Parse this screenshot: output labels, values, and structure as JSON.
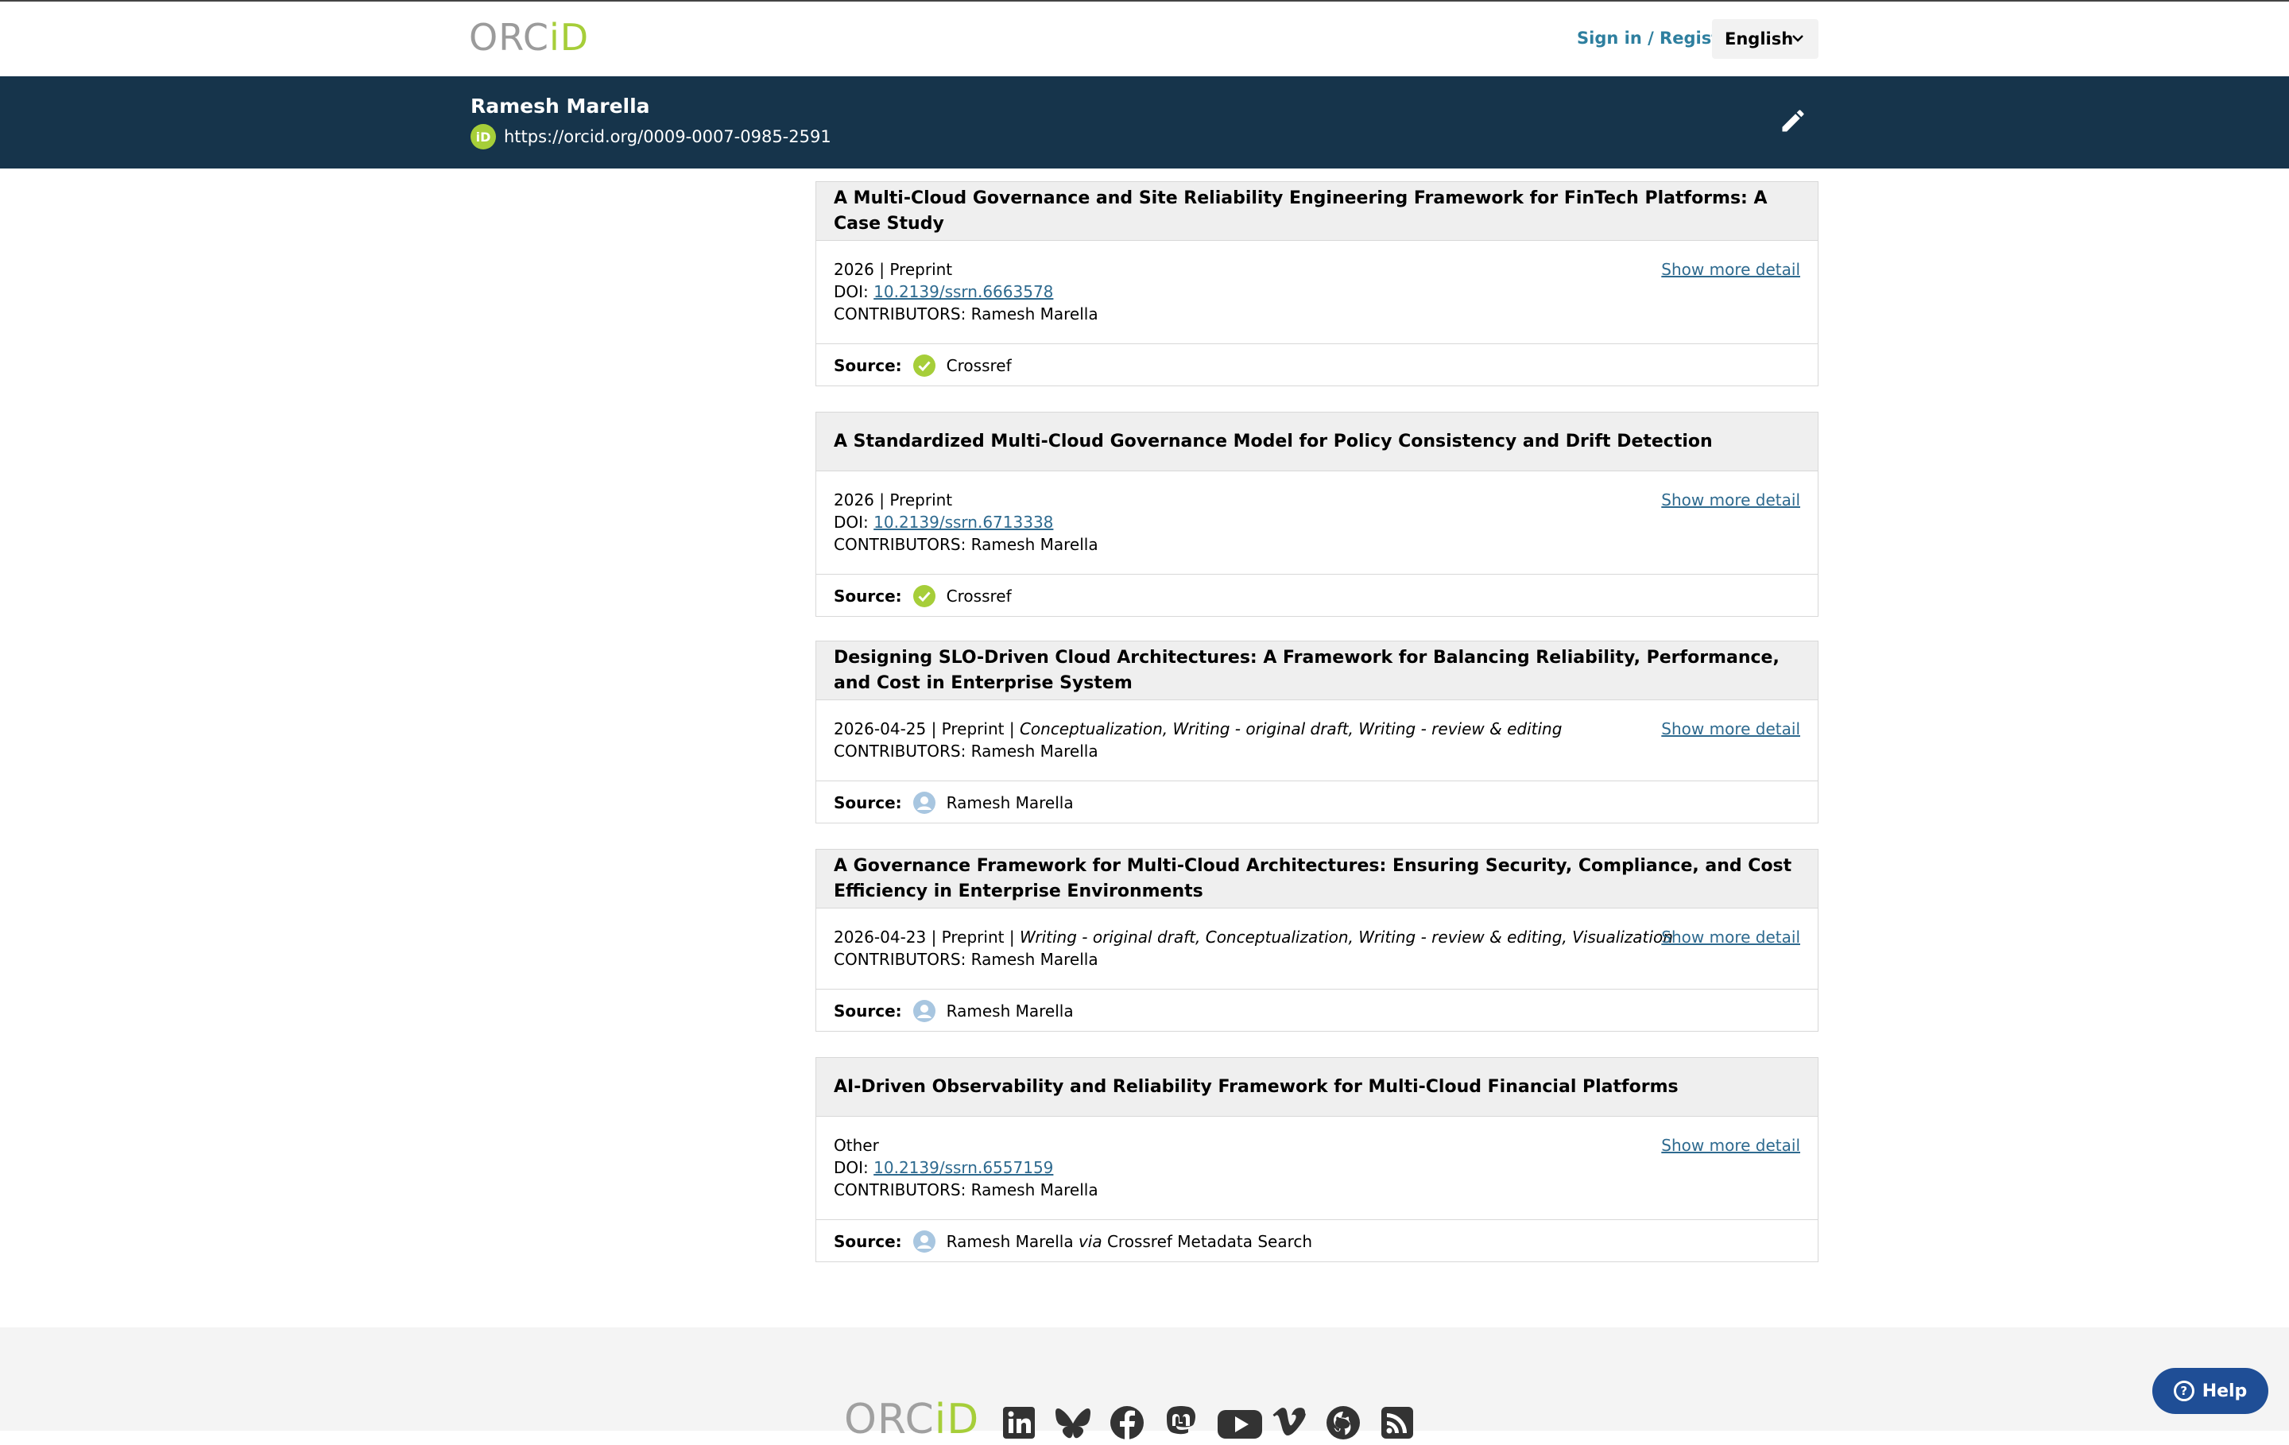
{
  "header": {
    "logo_orc": "ORC",
    "logo_id": "iD",
    "signin_label": "Sign in / Register",
    "language": "English"
  },
  "profile": {
    "name": "Ramesh Marella",
    "id_badge": "iD",
    "orcid_url": "https://orcid.org/0009-0007-0985-2591"
  },
  "works": [
    {
      "title": "A Multi-Cloud Governance and Site Reliability Engineering Framework for FinTech Platforms: A Case Study",
      "meta": "2026 | Preprint",
      "doi_label": "DOI: ",
      "doi": "10.2139/ssrn.6663578",
      "contributors": "CONTRIBUTORS: Ramesh Marella",
      "more": "Show more detail",
      "source_label": "Source:",
      "source": "Crossref",
      "source_icon": "check-circle-icon"
    },
    {
      "title": "A Standardized Multi-Cloud Governance Model for Policy Consistency and Drift Detection",
      "meta": "2026 | Preprint",
      "doi_label": "DOI: ",
      "doi": "10.2139/ssrn.6713338",
      "contributors": "CONTRIBUTORS: Ramesh Marella",
      "more": "Show more detail",
      "source_label": "Source:",
      "source": "Crossref",
      "source_icon": "check-circle-icon"
    },
    {
      "title": "Designing SLO-Driven Cloud Architectures: A Framework for Balancing Reliability, Performance, and Cost in Enterprise System",
      "meta": "2026-04-25 | Preprint | ",
      "roles": "Conceptualization, Writing - original draft, Writing - review & editing",
      "contributors": "CONTRIBUTORS: Ramesh Marella",
      "more": "Show more detail",
      "source_label": "Source:",
      "source": "Ramesh Marella",
      "source_icon": "user-icon"
    },
    {
      "title": "A Governance Framework for Multi-Cloud Architectures: Ensuring Security, Compliance, and Cost Efficiency in Enterprise Environments",
      "meta": "2026-04-23 | Preprint | ",
      "roles": "Writing - original draft, Conceptualization, Writing - review & editing, Visualization",
      "contributors": "CONTRIBUTORS: Ramesh Marella",
      "more": "Show more detail",
      "source_label": "Source:",
      "source": "Ramesh Marella",
      "source_icon": "user-icon"
    },
    {
      "title": "AI-Driven Observability and Reliability Framework for Multi-Cloud Financial Platforms",
      "meta": "Other",
      "doi_label": "DOI: ",
      "doi": "10.2139/ssrn.6557159",
      "contributors": "CONTRIBUTORS: Ramesh Marella",
      "more": "Show more detail",
      "source_label": "Source:",
      "source": "Ramesh Marella",
      "source_via": "via",
      "source_via_name": "Crossref Metadata Search",
      "source_icon": "user-icon"
    }
  ],
  "footer": {
    "logo_orc": "ORC",
    "logo_id": "iD",
    "social_icons": [
      "linkedin-icon",
      "bluesky-icon",
      "facebook-icon",
      "mastodon-icon",
      "youtube-icon",
      "vimeo-icon",
      "github-icon",
      "rss-icon"
    ]
  },
  "help": {
    "label": "Help",
    "q": "?"
  },
  "colors": {
    "banner": "#16344b",
    "accent_green": "#a6ce39",
    "link": "#2e6a8f",
    "help": "#1f4e96"
  }
}
